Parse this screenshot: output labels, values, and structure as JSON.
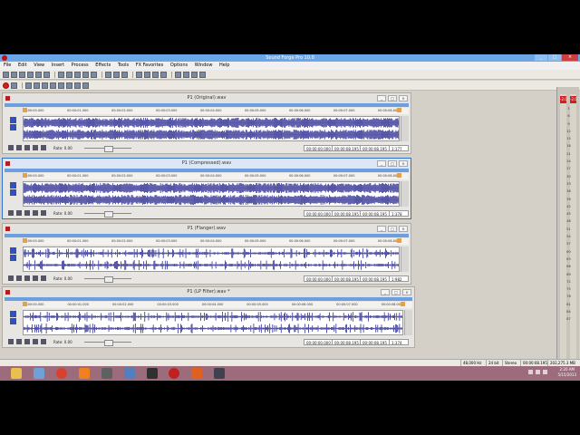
{
  "app": {
    "title": "Sound Forge Pro 10.0"
  },
  "menu": [
    "File",
    "Edit",
    "View",
    "Insert",
    "Process",
    "Effects",
    "Tools",
    "FX Favorites",
    "Options",
    "Window",
    "Help"
  ],
  "window_buttons": [
    "minimize",
    "maximize",
    "close"
  ],
  "documents": [
    {
      "title": "P1 (Original).wav",
      "rate_label": "Rate: 0.00",
      "cursor_time": "00:00:00.000",
      "selection_end": "00:00:08.195",
      "length": "00:00:08.195",
      "zoom": "1:177",
      "ruler": [
        "00:00:00.000",
        "00:00:01.000",
        "00:00:02.000",
        "00:00:03.000",
        "00:00:04.000",
        "00:00:05.000",
        "00:00:06.000",
        "00:00:07.000",
        "00:00:08.000"
      ],
      "wave_style": "dense",
      "active": false
    },
    {
      "title": "P1 (Compressed).wav",
      "rate_label": "Rate: 0.00",
      "cursor_time": "00:00:00.000",
      "selection_end": "00:00:08.195",
      "length": "00:00:08.195",
      "zoom": "1:378",
      "ruler": [
        "00:00:00.000",
        "00:00:01.000",
        "00:00:02.000",
        "00:00:03.000",
        "00:00:04.000",
        "00:00:05.000",
        "00:00:06.000",
        "00:00:07.000",
        "00:00:08.000"
      ],
      "wave_style": "dense",
      "active": true
    },
    {
      "title": "P1 (Flanger).wav",
      "rate_label": "Rate: 0.00",
      "cursor_time": "00:00:00.000",
      "selection_end": "00:00:08.195",
      "length": "00:00:08.195",
      "zoom": "1:982",
      "ruler": [
        "00:00:00.000",
        "00:00:01.000",
        "00:00:02.000",
        "00:00:03.000",
        "00:00:04.000",
        "00:00:05.000",
        "00:00:06.000",
        "00:00:07.000",
        "00:00:08.000"
      ],
      "wave_style": "sparse",
      "active": false
    },
    {
      "title": "P1 (LP Filter).wav *",
      "rate_label": "Rate: 0.00",
      "cursor_time": "00:00:00.000",
      "selection_end": "00:00:08.195",
      "length": "00:00:08.195",
      "zoom": "1:374",
      "ruler": [
        "00:00:00.000",
        "00:00:01.000",
        "00:00:02.000",
        "00:00:03.000",
        "00:00:04.000",
        "00:00:05.000",
        "00:00:06.000",
        "00:00:07.000",
        "00:00:08.000"
      ],
      "wave_style": "sparse",
      "active": false
    }
  ],
  "meter": {
    "clip_labels": [
      "-2.0",
      "-2.0"
    ],
    "ticks": [
      "3",
      "6",
      "9",
      "12",
      "15",
      "18",
      "21",
      "24",
      "27",
      "30",
      "33",
      "36",
      "39",
      "42",
      "45",
      "48",
      "51",
      "54",
      "57",
      "60",
      "63",
      "66",
      "69",
      "72",
      "75",
      "78",
      "81",
      "84",
      "87"
    ]
  },
  "status": {
    "sample_rate": "48,000 Hz",
    "bit_depth": "24 bit",
    "channels": "Stereo",
    "length": "00:00:08.195",
    "disk_space": "202,275.3 MB"
  },
  "taskbar": {
    "time": "2:20 AM",
    "date": "5/15/2013",
    "apps": [
      "File Explorer",
      "Computer",
      "Chrome",
      "VLC",
      "Sound Forge",
      "Editor",
      "Terminal",
      "Record",
      "Media",
      "Tools"
    ]
  },
  "colors": {
    "title_blue": "#6aa6e8",
    "wave": "#1a1a8a",
    "accent": "#3050c0",
    "taskbar": "#9c6c7c"
  }
}
